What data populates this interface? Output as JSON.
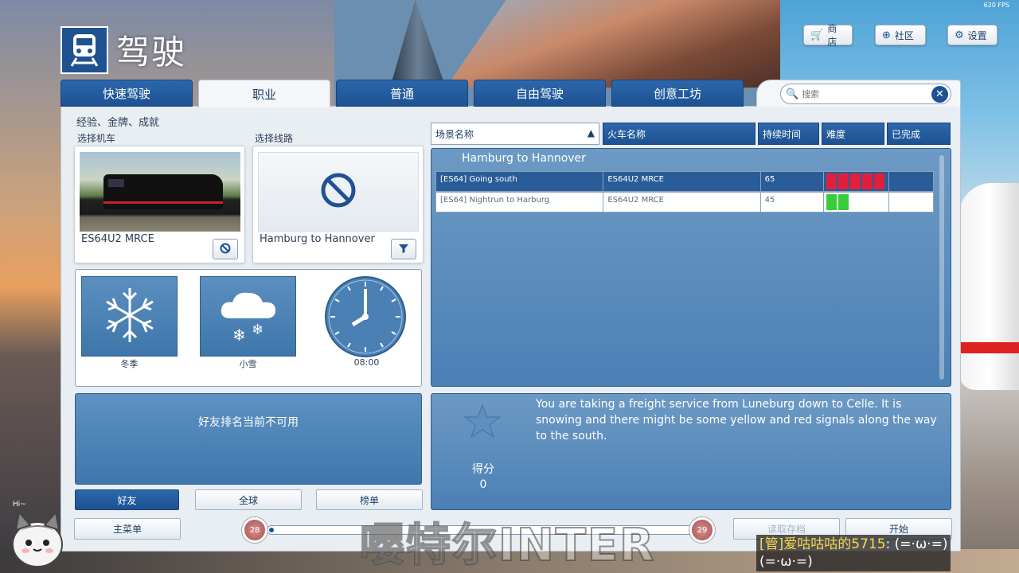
{
  "header": {
    "title": "驾驶",
    "fps": "620 FPS"
  },
  "top_buttons": {
    "store": "商店",
    "community": "社区",
    "settings": "设置"
  },
  "tabs": [
    "快速驾驶",
    "职业",
    "普通",
    "自由驾驶",
    "创意工坊"
  ],
  "active_tab": 1,
  "search": {
    "placeholder": "搜索"
  },
  "left": {
    "section_title": "经验、金牌、成就",
    "loco_label": "选择机车",
    "route_label": "选择线路",
    "loco_name": "ES64U2 MRCE",
    "route_name": "Hamburg to Hannover",
    "season": "冬季",
    "weather": "小雪",
    "time": "08:00",
    "friends_unavailable": "好友排名当前不可用",
    "leaderboard_buttons": [
      "好友",
      "全球",
      "榜单"
    ],
    "main_menu": "主菜单"
  },
  "slider": {
    "left_value": "28",
    "right_value": "29",
    "fill_fraction": 0.01
  },
  "bottom_buttons": {
    "load_save": "读取存档",
    "start": "开始"
  },
  "table": {
    "columns": [
      "场景名称",
      "火车名称",
      "持续时间",
      "难度",
      "已完成"
    ],
    "group": "Hamburg to Hannover",
    "rows": [
      {
        "scenario": "[ES64] Going south",
        "train": "ES64U2 MRCE",
        "duration": "65",
        "difficulty": 5,
        "difficulty_color": "#e0203a",
        "completed": "",
        "selected": true
      },
      {
        "scenario": "[ES64] Nightrun to Harburg",
        "train": "ES64U2 MRCE",
        "duration": "45",
        "difficulty": 2,
        "difficulty_color": "#36cc3a",
        "completed": "",
        "selected": false
      }
    ]
  },
  "description": {
    "text": "You are taking a freight service from Luneburg down to Celle. It is snowing and there might be some yellow and red signals along the way to the south.",
    "score_label": "得分",
    "score_value": "0"
  },
  "overlay": {
    "watermark": "嘤特尔INTER",
    "chat_name": "[管]爱咕咕咕的5715",
    "chat_msg": ": (=·ω·=)",
    "chat_msg2": "(=·ω·=)",
    "mascot_text": "Hi~"
  }
}
